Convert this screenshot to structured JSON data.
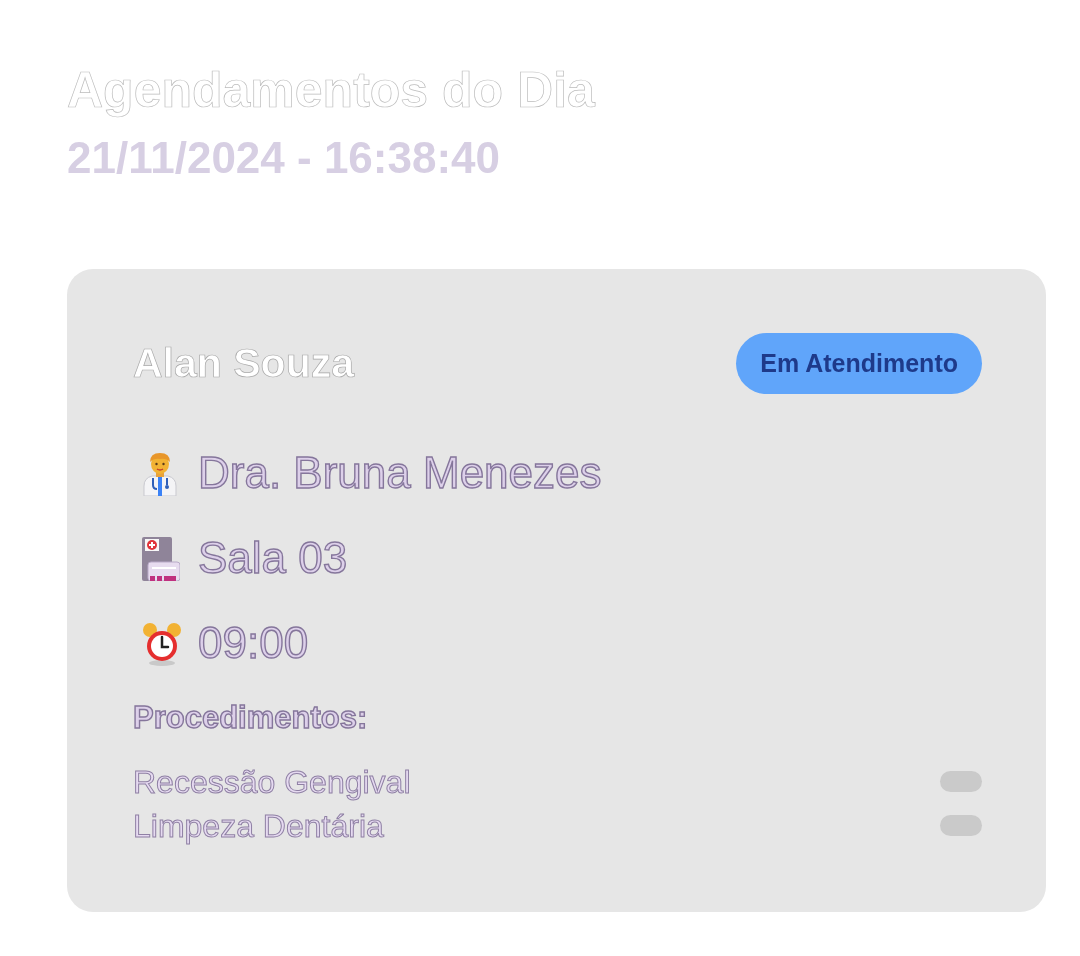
{
  "page": {
    "title": "Agendamentos do Dia",
    "datetime": "21/11/2024 - 16:38:40"
  },
  "appointment": {
    "patient": "Alan Souza",
    "status": {
      "label": "Em Atendimento",
      "kind": "in_service"
    },
    "details": [
      {
        "kind": "doctor",
        "text": "Dra. Bruna Menezes"
      },
      {
        "kind": "room",
        "text": "Sala 03"
      },
      {
        "kind": "time",
        "text": "09:00"
      }
    ],
    "procedures_heading": "Procedimentos:",
    "procedures": [
      {
        "name": "Recessão Gengival"
      },
      {
        "name": "Limpeza Dentária"
      }
    ]
  }
}
